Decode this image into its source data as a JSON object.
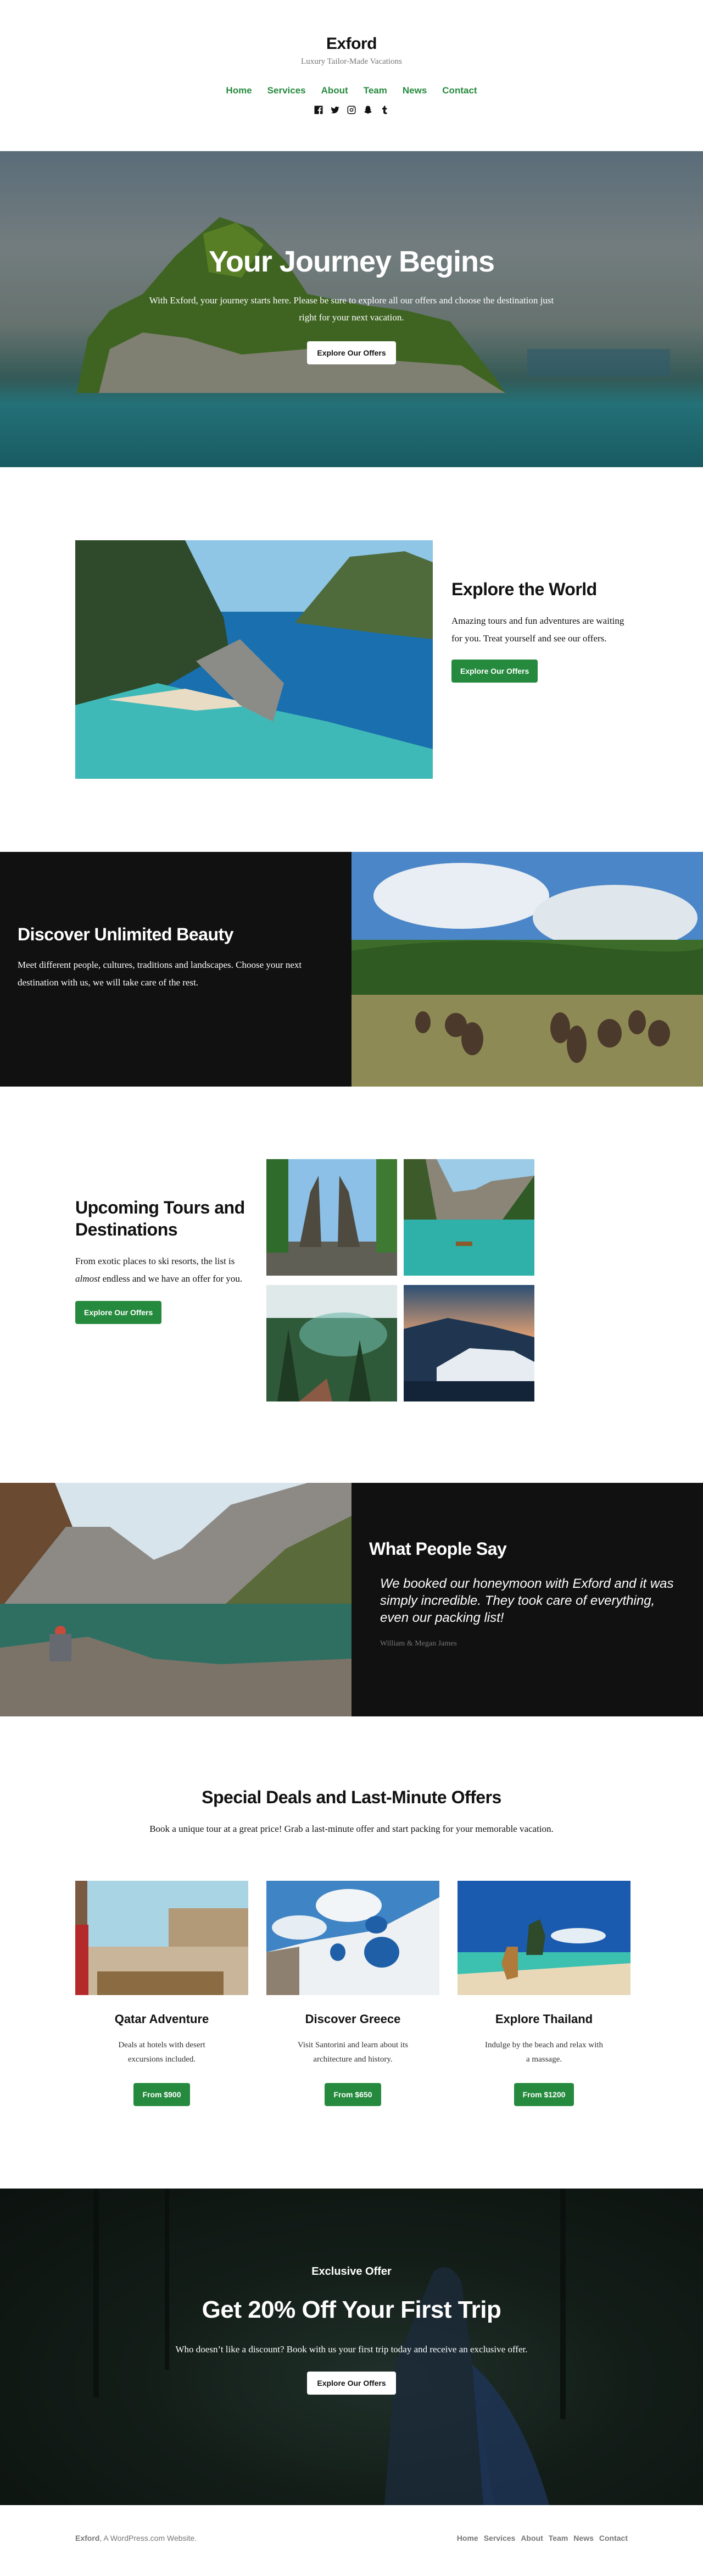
{
  "header": {
    "site_title": "Exford",
    "tagline": "Luxury Tailor-Made Vacations",
    "nav": [
      "Home",
      "Services",
      "About",
      "Team",
      "News",
      "Contact"
    ],
    "social_icons": [
      "facebook-icon",
      "twitter-icon",
      "instagram-icon",
      "snapchat-icon",
      "tumblr-icon"
    ]
  },
  "hero": {
    "title": "Your Journey Begins",
    "text": "With Exford, your journey starts here. Please be sure to explore all our offers and choose the destination just right for your next vacation.",
    "button": "Explore Our Offers",
    "image_alt": "Tropical rocky island covered in green forest surrounded by turquoise sea"
  },
  "explore": {
    "title": "Explore the World",
    "text": "Amazing tours and fun adventures are waiting for you. Treat yourself and see our offers.",
    "button": "Explore Our Offers",
    "image_alt": "Aerial view of a lagoon with limestone cliffs and a sandy beach"
  },
  "discover": {
    "title": "Discover Unlimited Beauty",
    "text": "Meet different people, cultures, traditions and landscapes. Choose your next destination with us, we will take care of the rest.",
    "image_alt": "Elephants bathing in a river surrounded by jungle"
  },
  "tours": {
    "title": "Upcoming Tours and Destinations",
    "text_before": "From exotic places to ski resorts, the list is ",
    "text_em": "almost",
    "text_after": " endless and we have an offer for you.",
    "button": "Explore Our Offers",
    "images": [
      "Temple gate in Bali",
      "Mountain lake with rowing boat",
      "Tropical rice terraces in sunlight",
      "Snowy ski village at sunset"
    ]
  },
  "testimonial": {
    "title": "What People Say",
    "quote": "We booked our honeymoon with Exford and it was simply incredible. They took care of everything, even our packing list!",
    "author": "William & Megan James",
    "image_alt": "Couple sitting by a mountain lake"
  },
  "deals": {
    "title": "Special Deals and Last-Minute Offers",
    "intro": "Book a unique tour at a great price! Grab a last-minute offer and start packing for your memorable vacation.",
    "cards": [
      {
        "title": "Qatar Adventure",
        "text": "Deals at hotels with desert excursions included.",
        "button": "From $900",
        "image_alt": "Market square with camels in Qatar"
      },
      {
        "title": "Discover Greece",
        "text": "Visit Santorini and learn about its architecture and history.",
        "button": "From $650",
        "image_alt": "Blue domes of Santorini"
      },
      {
        "title": "Explore Thailand",
        "text": "Indulge by the beach and relax with a massage.",
        "button": "From $1200",
        "image_alt": "Longtail boat on a Thai beach"
      }
    ]
  },
  "offer": {
    "eyebrow": "Exclusive Offer",
    "title": "Get 20% Off Your First Trip",
    "text": "Who doesn’t like a discount? Book with us your first trip today and receive an exclusive offer.",
    "button": "Explore Our Offers"
  },
  "footer": {
    "site_name": "Exford",
    "credit_suffix": ", A WordPress.com Website.",
    "nav": [
      "Home",
      "Services",
      "About",
      "Team",
      "News",
      "Contact"
    ]
  },
  "colors": {
    "accent": "#268a3e",
    "dark": "#111111",
    "muted": "#767676"
  }
}
